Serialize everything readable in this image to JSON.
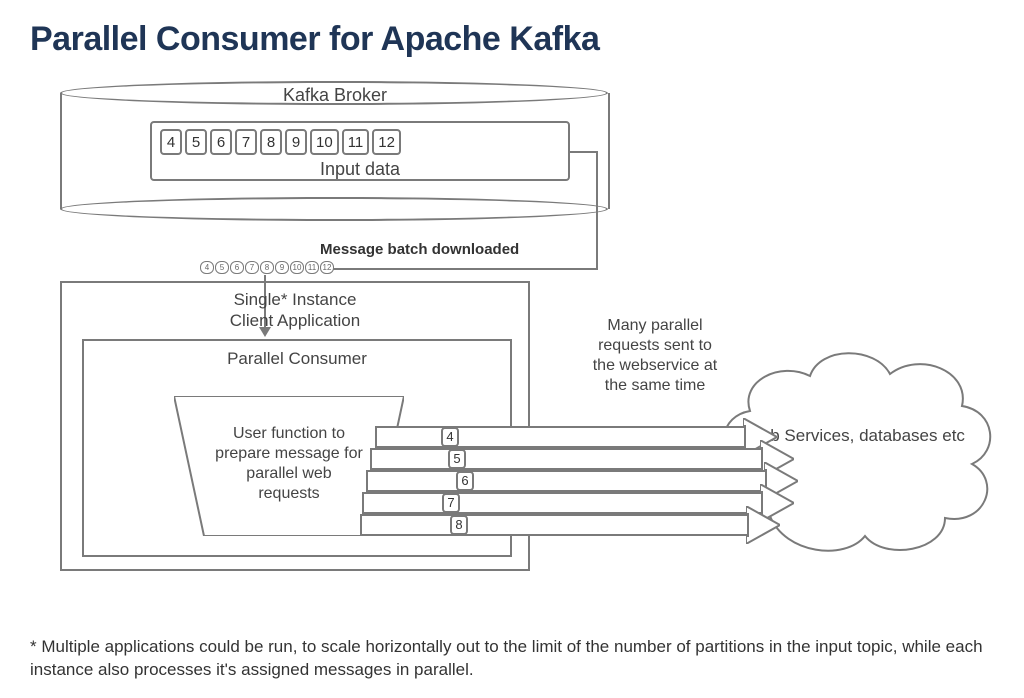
{
  "title": "Parallel Consumer for Apache Kafka",
  "broker": {
    "label": "Kafka Broker",
    "queue_label": "Input data",
    "messages": [
      "4",
      "5",
      "6",
      "7",
      "8",
      "9",
      "10",
      "11",
      "12"
    ]
  },
  "download_label": "Message batch downloaded",
  "mini_messages": [
    "4",
    "5",
    "6",
    "7",
    "8",
    "9",
    "10",
    "11",
    "12"
  ],
  "client": {
    "label_line1": "Single* Instance",
    "label_line2": "Client Application"
  },
  "consumer": {
    "label": "Parallel Consumer",
    "user_fn_line1": "User function to",
    "user_fn_line2": "prepare message for",
    "user_fn_line3": "parallel web",
    "user_fn_line4": "requests"
  },
  "parallel_note": {
    "line1": "Many parallel",
    "line2": "requests sent to",
    "line3": "the webservice at",
    "line4": "the same time"
  },
  "arrow_numbers": [
    "4",
    "5",
    "6",
    "7",
    "8"
  ],
  "cloud_label": "Web Services, databases etc",
  "footnote": "* Multiple applications could be run, to scale horizontally out to the limit of the number of partitions in the input topic, while each instance also processes it's assigned messages in parallel."
}
